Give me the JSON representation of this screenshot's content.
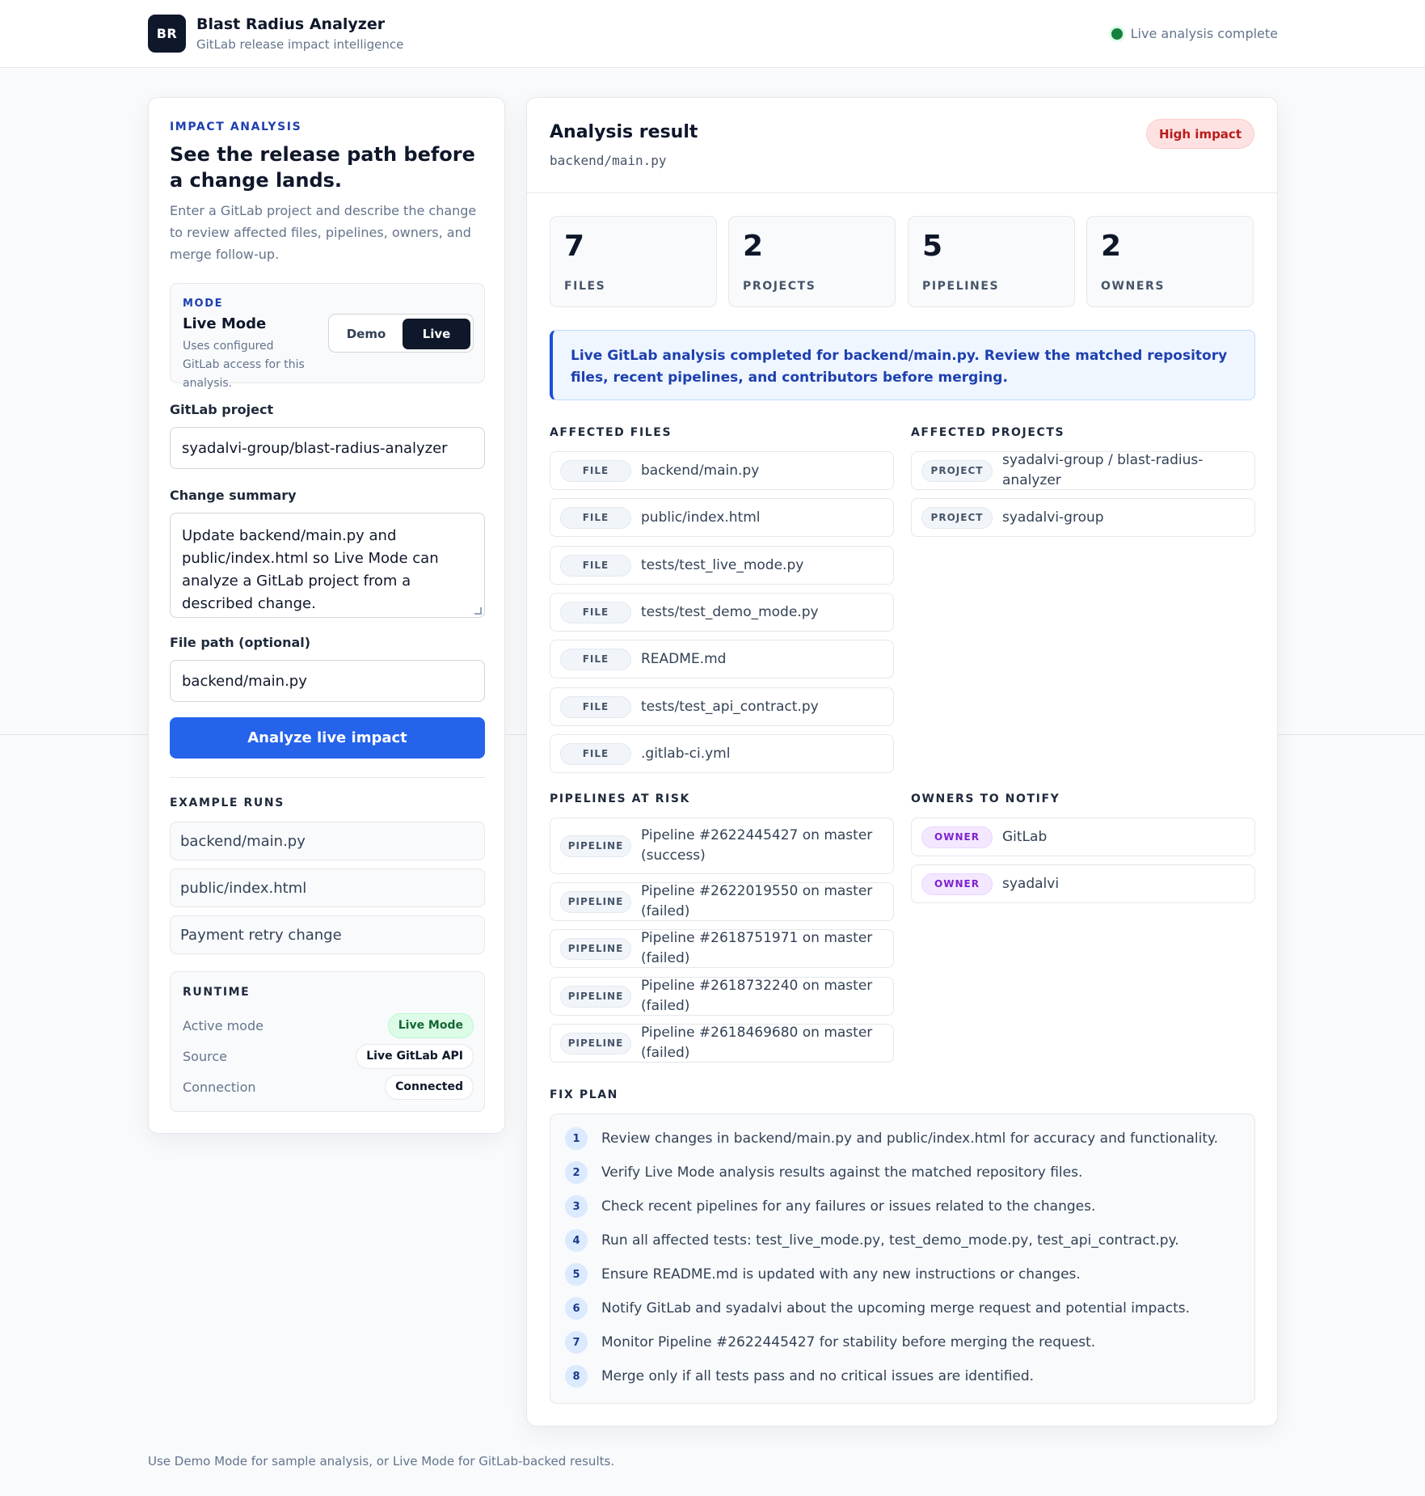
{
  "header": {
    "logo_text": "BR",
    "title": "Blast Radius Analyzer",
    "subtitle": "GitLab release impact intelligence",
    "status_text": "Live analysis complete"
  },
  "left": {
    "eyebrow": "IMPACT ANALYSIS",
    "title": "See the release path before a change lands.",
    "description": "Enter a GitLab project and describe the change to review affected files, pipelines, owners, and merge follow-up.",
    "mode": {
      "eyebrow": "MODE",
      "name": "Live Mode",
      "description": "Uses configured GitLab access for this analysis.",
      "demo_label": "Demo",
      "live_label": "Live"
    },
    "project_label": "GitLab project",
    "project_value": "syadalvi-group/blast-radius-analyzer",
    "summary_label": "Change summary",
    "summary_value": "Update backend/main.py and public/index.html so Live Mode can analyze a GitLab project from a described change.",
    "filepath_label": "File path (optional)",
    "filepath_value": "backend/main.py",
    "analyze_label": "Analyze live impact",
    "examples_label": "EXAMPLE RUNS",
    "examples": [
      "backend/main.py",
      "public/index.html",
      "Payment retry change"
    ],
    "runtime": {
      "label": "RUNTIME",
      "rows": [
        {
          "key": "Active mode",
          "value": "Live Mode"
        },
        {
          "key": "Source",
          "value": "Live GitLab API"
        },
        {
          "key": "Connection",
          "value": "Connected"
        }
      ]
    }
  },
  "result": {
    "title": "Analysis result",
    "path": "backend/main.py",
    "impact_badge": "High impact",
    "stats": [
      {
        "value": "7",
        "label": "FILES"
      },
      {
        "value": "2",
        "label": "PROJECTS"
      },
      {
        "value": "5",
        "label": "PIPELINES"
      },
      {
        "value": "2",
        "label": "OWNERS"
      }
    ],
    "callout": "Live GitLab analysis completed for backend/main.py. Review the matched repository files, recent pipelines, and contributors before merging.",
    "files_label": "AFFECTED FILES",
    "file_tag": "FILE",
    "files": [
      "backend/main.py",
      "public/index.html",
      "tests/test_live_mode.py",
      "tests/test_demo_mode.py",
      "README.md",
      "tests/test_api_contract.py",
      ".gitlab-ci.yml"
    ],
    "projects_label": "AFFECTED PROJECTS",
    "project_tag": "PROJECT",
    "projects": [
      "syadalvi-group / blast-radius-analyzer",
      "syadalvi-group"
    ],
    "pipelines_label": "PIPELINES AT RISK",
    "pipeline_tag": "PIPELINE",
    "pipelines": [
      "Pipeline #2622445427 on master (success)",
      "Pipeline #2622019550 on master (failed)",
      "Pipeline #2618751971 on master (failed)",
      "Pipeline #2618732240 on master (failed)",
      "Pipeline #2618469680 on master (failed)"
    ],
    "owners_label": "OWNERS TO NOTIFY",
    "owner_tag": "OWNER",
    "owners": [
      "GitLab",
      "syadalvi"
    ],
    "fix_label": "FIX PLAN",
    "fix_plan": [
      {
        "n": "1",
        "text": "Review changes in backend/main.py and public/index.html for accuracy and functionality."
      },
      {
        "n": "2",
        "text": "Verify Live Mode analysis results against the matched repository files."
      },
      {
        "n": "3",
        "text": "Check recent pipelines for any failures or issues related to the changes."
      },
      {
        "n": "4",
        "text": "Run all affected tests: test_live_mode.py, test_demo_mode.py, test_api_contract.py."
      },
      {
        "n": "5",
        "text": "Ensure README.md is updated with any new instructions or changes."
      },
      {
        "n": "6",
        "text": "Notify GitLab and syadalvi about the upcoming merge request and potential impacts."
      },
      {
        "n": "7",
        "text": "Monitor Pipeline #2622445427 for stability before merging the request."
      },
      {
        "n": "8",
        "text": "Merge only if all tests pass and no critical issues are identified."
      }
    ]
  },
  "footer": "Use Demo Mode for sample analysis, or Live Mode for GitLab-backed results.",
  "colors": {
    "accent": "#2563eb",
    "dark": "#0f172a",
    "high_impact": "#b91c1c",
    "live_green": "#15803d"
  }
}
